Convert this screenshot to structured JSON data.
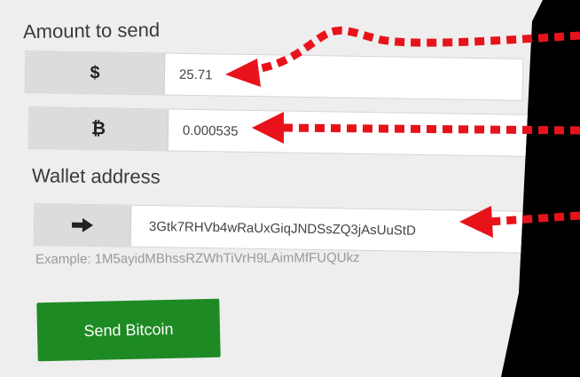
{
  "form": {
    "amount_heading": "Amount to send",
    "usd_symbol": "$",
    "usd_value": "25.71",
    "btc_symbol": "₿",
    "btc_value": "0.000535",
    "wallet_heading": "Wallet address",
    "wallet_value": "3Gtk7RHVb4wRaUxGiqJNDSsZQ3jAsUuStD",
    "wallet_example": "Example: 1M5ayidMBhssRZWhTiVrH9LAimMfFUQUkz",
    "send_label": "Send Bitcoin"
  },
  "icons": {
    "arrow": "arrow-right-icon",
    "clipboard": "clipboard-icon"
  },
  "colors": {
    "accent_green": "#1e8a23",
    "annotation_red": "#e8131a",
    "panel_bg": "#eeeeee",
    "addon_bg": "#dcdcdc"
  }
}
